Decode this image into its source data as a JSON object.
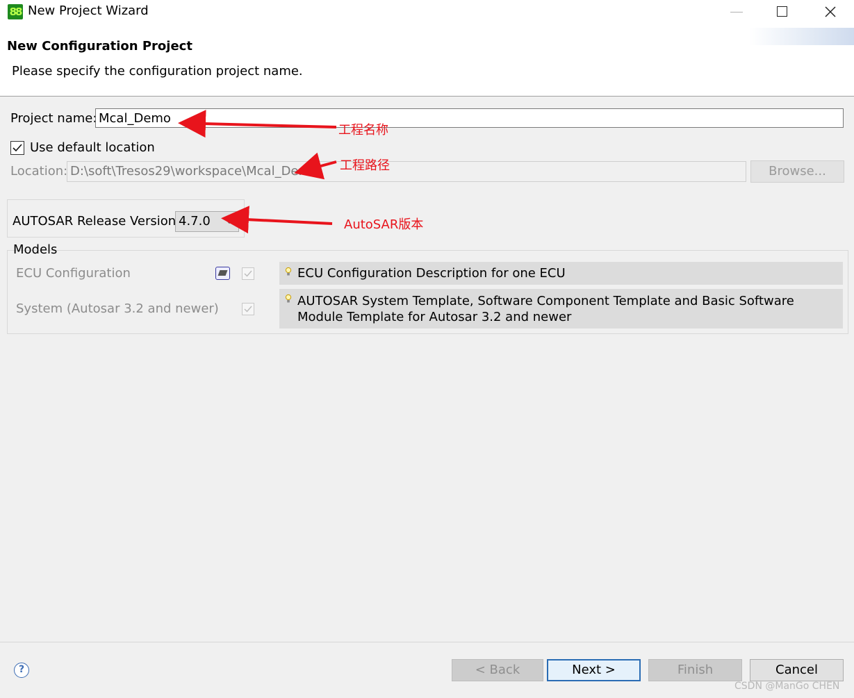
{
  "window": {
    "title": "New Project Wizard",
    "icon": "tresos-app-icon"
  },
  "header": {
    "title": "New Configuration Project",
    "description": "Please specify the configuration project name."
  },
  "project": {
    "name_label": "Project name:",
    "name_value": "Mcal_Demo",
    "use_default_label": "Use default location",
    "use_default_checked": true,
    "location_label": "Location:",
    "location_value": "D:\\soft\\Tresos29\\workspace\\Mcal_Demo",
    "browse_label": "Browse..."
  },
  "autosar": {
    "label": "AUTOSAR Release Version:",
    "selected": "4.7.0"
  },
  "models": {
    "legend": "Models",
    "items": [
      {
        "name": "ECU Configuration",
        "description": "ECU Configuration Description for one ECU",
        "checked": true
      },
      {
        "name": "System (Autosar 3.2 and newer)",
        "description": "AUTOSAR System Template, Software Component Template and Basic Software Module Template for Autosar 3.2 and newer",
        "checked": true
      }
    ]
  },
  "annotations": {
    "name": "工程名称",
    "path": "工程路径",
    "version": "AutoSAR版本",
    "color": "#e8141c"
  },
  "buttons": {
    "help": "?",
    "back": "< Back",
    "next": "Next >",
    "finish": "Finish",
    "cancel": "Cancel"
  },
  "watermark": "CSDN @ManGo CHEN"
}
